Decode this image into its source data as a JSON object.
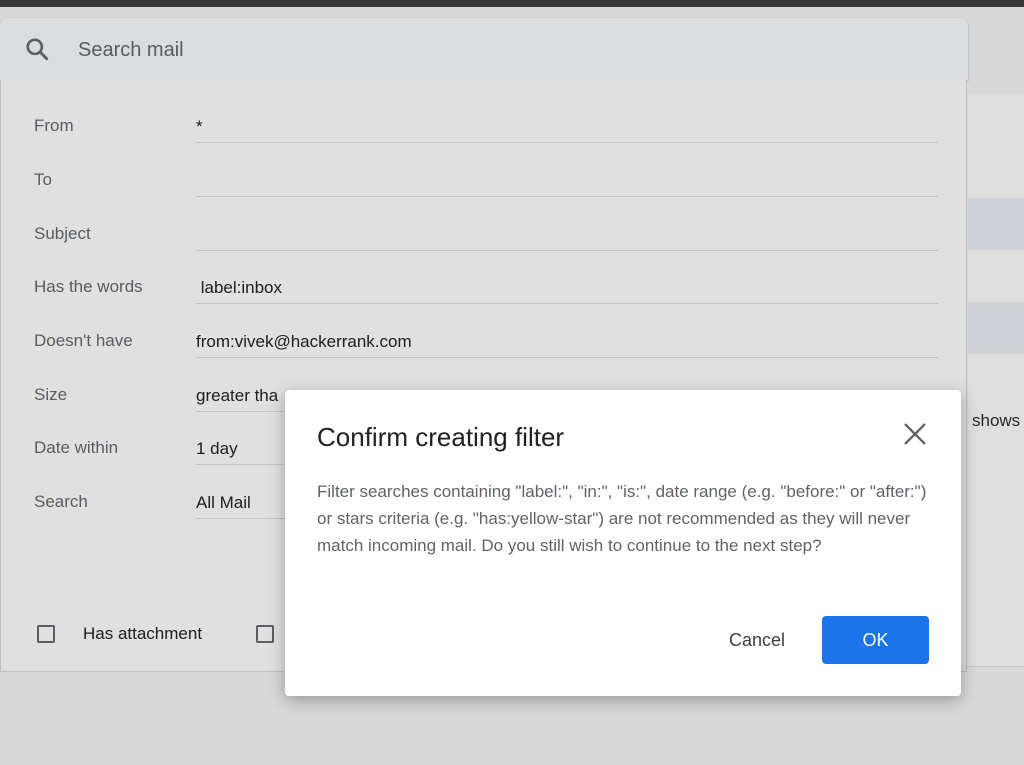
{
  "search": {
    "placeholder": "Search mail"
  },
  "filter": {
    "fields": [
      {
        "label": "From",
        "value": "*"
      },
      {
        "label": "To",
        "value": ""
      },
      {
        "label": "Subject",
        "value": ""
      },
      {
        "label": "Has the words",
        "value": " label:inbox"
      },
      {
        "label": "Doesn't have",
        "value": "from:vivek@hackerrank.com"
      },
      {
        "label": "Size",
        "value": "greater tha"
      },
      {
        "label": "Date within",
        "value": "1 day"
      },
      {
        "label": "Search",
        "value": "All Mail"
      }
    ],
    "has_attachment_label": "Has attachment"
  },
  "background": {
    "partial_text": "shows"
  },
  "dialog": {
    "title": "Confirm creating filter",
    "message": "Filter searches containing \"label:\", \"in:\", \"is:\", date range (e.g. \"before:\" or \"after:\") or stars criteria (e.g. \"has:yellow-star\") are not recommended as they will never match incoming mail. Do you still wish to continue to the next step?",
    "cancel_label": "Cancel",
    "ok_label": "OK"
  },
  "colors": {
    "primary_button": "#1a73e8",
    "dialog_background": "#ffffff"
  }
}
